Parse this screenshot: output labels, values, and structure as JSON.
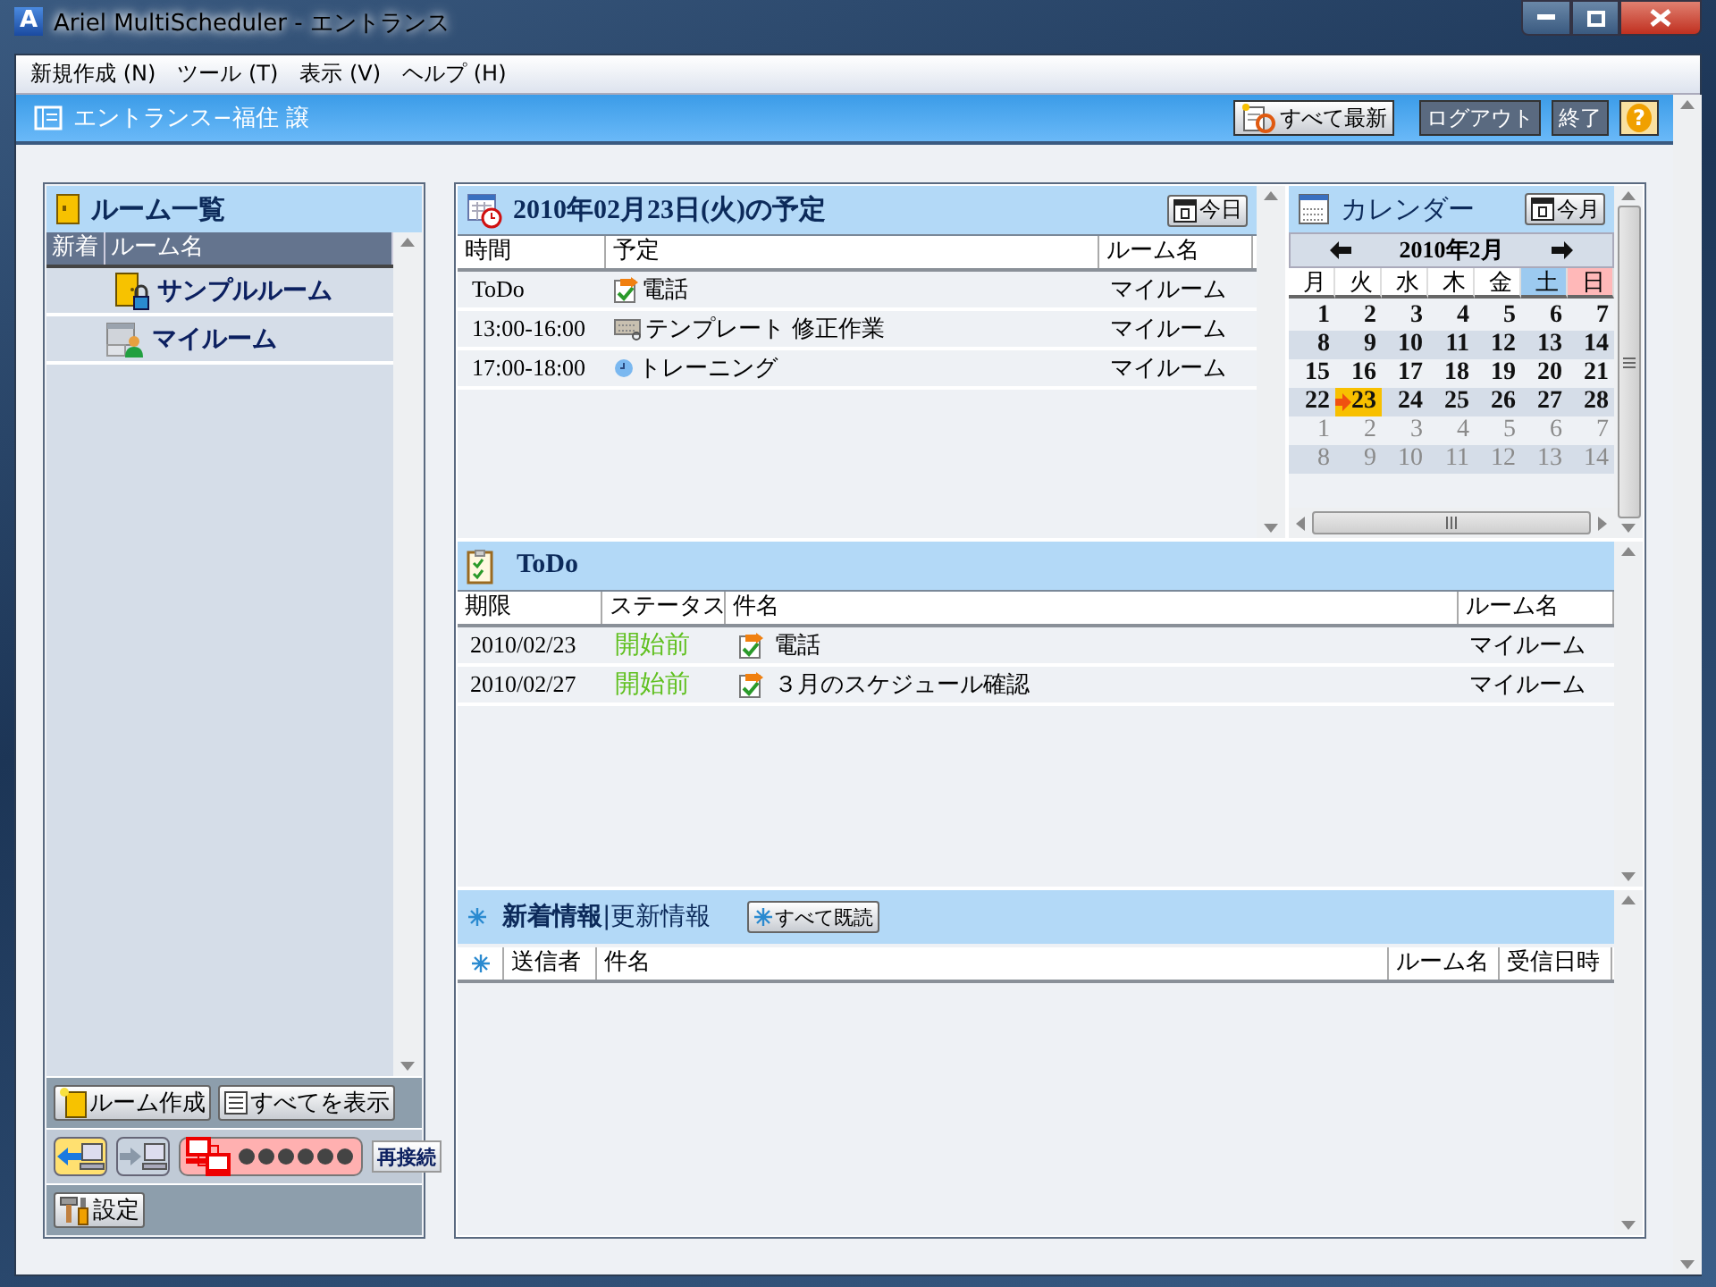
{
  "window": {
    "icon_letter": "A",
    "title": "Ariel MultiScheduler - エントランス"
  },
  "menu": [
    "新規作成 (N)",
    "ツール (T)",
    "表示 (V)",
    "ヘルプ (H)"
  ],
  "header": {
    "title": "エントランス−福住 譲",
    "buttons": [
      {
        "label": "すべて最新",
        "kind": "refresh"
      },
      {
        "label": "ログアウト",
        "kind": "dark"
      },
      {
        "label": "終了",
        "kind": "dark"
      },
      {
        "label": "?",
        "kind": "help"
      }
    ]
  },
  "rooms": {
    "title": "ルーム一覧",
    "columns": [
      "新着",
      "ルーム名"
    ],
    "items": [
      {
        "name": "サンプルルーム",
        "kind": "locked"
      },
      {
        "name": "マイルーム",
        "kind": "personal"
      }
    ],
    "actions": [
      {
        "label": "ルーム作成",
        "kind": "create"
      },
      {
        "label": "すべてを表示",
        "kind": "list"
      }
    ],
    "sync_buttons": [
      {
        "kind": "download",
        "selected": true
      },
      {
        "kind": "upload",
        "selected": false
      }
    ],
    "reconnect": "再接続",
    "settings": "設定"
  },
  "schedule": {
    "title": "2010年02月23日(火)の予定",
    "today_button": "今日",
    "columns": [
      "時間",
      "予定",
      "ルーム名"
    ],
    "rows": [
      {
        "time": "ToDo",
        "kind": "todo",
        "title": "電話",
        "room": "マイルーム"
      },
      {
        "time": "13:00-16:00",
        "kind": "template",
        "title": "テンプレート 修正作業",
        "room": "マイルーム"
      },
      {
        "time": "17:00-18:00",
        "kind": "event",
        "title": "トレーニング",
        "room": "マイルーム"
      }
    ]
  },
  "calendar": {
    "title": "カレンダー",
    "month_button": "今月",
    "month": "2010年2月",
    "weekdays": [
      {
        "label": "月",
        "color": "#ffffff"
      },
      {
        "label": "火",
        "color": "#ffffff"
      },
      {
        "label": "水",
        "color": "#ffffff"
      },
      {
        "label": "木",
        "color": "#ffffff"
      },
      {
        "label": "金",
        "color": "#ffffff"
      },
      {
        "label": "土",
        "color": "#9ccaf0"
      },
      {
        "label": "日",
        "color": "#ffb8b8"
      }
    ],
    "weeks": [
      {
        "days": [
          {
            "label": "1",
            "in_month": true,
            "today": false
          },
          {
            "label": "2",
            "in_month": true,
            "today": false
          },
          {
            "label": "3",
            "in_month": true,
            "today": false
          },
          {
            "label": "4",
            "in_month": true,
            "today": false
          },
          {
            "label": "5",
            "in_month": true,
            "today": false
          },
          {
            "label": "6",
            "in_month": true,
            "today": false
          },
          {
            "label": "7",
            "in_month": true,
            "today": false
          }
        ]
      },
      {
        "days": [
          {
            "label": "8",
            "in_month": true,
            "today": false
          },
          {
            "label": "9",
            "in_month": true,
            "today": false
          },
          {
            "label": "10",
            "in_month": true,
            "today": false
          },
          {
            "label": "11",
            "in_month": true,
            "today": false
          },
          {
            "label": "12",
            "in_month": true,
            "today": false
          },
          {
            "label": "13",
            "in_month": true,
            "today": false
          },
          {
            "label": "14",
            "in_month": true,
            "today": false
          }
        ]
      },
      {
        "days": [
          {
            "label": "15",
            "in_month": true,
            "today": false
          },
          {
            "label": "16",
            "in_month": true,
            "today": false
          },
          {
            "label": "17",
            "in_month": true,
            "today": false
          },
          {
            "label": "18",
            "in_month": true,
            "today": false
          },
          {
            "label": "19",
            "in_month": true,
            "today": false
          },
          {
            "label": "20",
            "in_month": true,
            "today": false
          },
          {
            "label": "21",
            "in_month": true,
            "today": false
          }
        ]
      },
      {
        "days": [
          {
            "label": "22",
            "in_month": true,
            "today": false
          },
          {
            "label": "23",
            "in_month": true,
            "today": true
          },
          {
            "label": "24",
            "in_month": true,
            "today": false
          },
          {
            "label": "25",
            "in_month": true,
            "today": false
          },
          {
            "label": "26",
            "in_month": true,
            "today": false
          },
          {
            "label": "27",
            "in_month": true,
            "today": false
          },
          {
            "label": "28",
            "in_month": true,
            "today": false
          }
        ]
      },
      {
        "days": [
          {
            "label": "1",
            "in_month": false,
            "today": false
          },
          {
            "label": "2",
            "in_month": false,
            "today": false
          },
          {
            "label": "3",
            "in_month": false,
            "today": false
          },
          {
            "label": "4",
            "in_month": false,
            "today": false
          },
          {
            "label": "5",
            "in_month": false,
            "today": false
          },
          {
            "label": "6",
            "in_month": false,
            "today": false
          },
          {
            "label": "7",
            "in_month": false,
            "today": false
          }
        ]
      },
      {
        "days": [
          {
            "label": "8",
            "in_month": false,
            "today": false
          },
          {
            "label": "9",
            "in_month": false,
            "today": false
          },
          {
            "label": "10",
            "in_month": false,
            "today": false
          },
          {
            "label": "11",
            "in_month": false,
            "today": false
          },
          {
            "label": "12",
            "in_month": false,
            "today": false
          },
          {
            "label": "13",
            "in_month": false,
            "today": false
          },
          {
            "label": "14",
            "in_month": false,
            "today": false
          }
        ]
      }
    ]
  },
  "todo": {
    "title": "ToDo",
    "columns": [
      "期限",
      "ステータス",
      "件名",
      "ルーム名"
    ],
    "rows": [
      {
        "due": "2010/02/23",
        "status": "開始前",
        "title": "電話",
        "room": "マイルーム"
      },
      {
        "due": "2010/02/27",
        "status": "開始前",
        "title": "３月のスケジュール確認",
        "room": "マイルーム"
      }
    ]
  },
  "news": {
    "title": "**新着情報**|更新情報",
    "mark_all_button": "すべて既読",
    "columns": [
      "送信者",
      "件名",
      "ルーム名",
      "受信日時"
    ]
  }
}
